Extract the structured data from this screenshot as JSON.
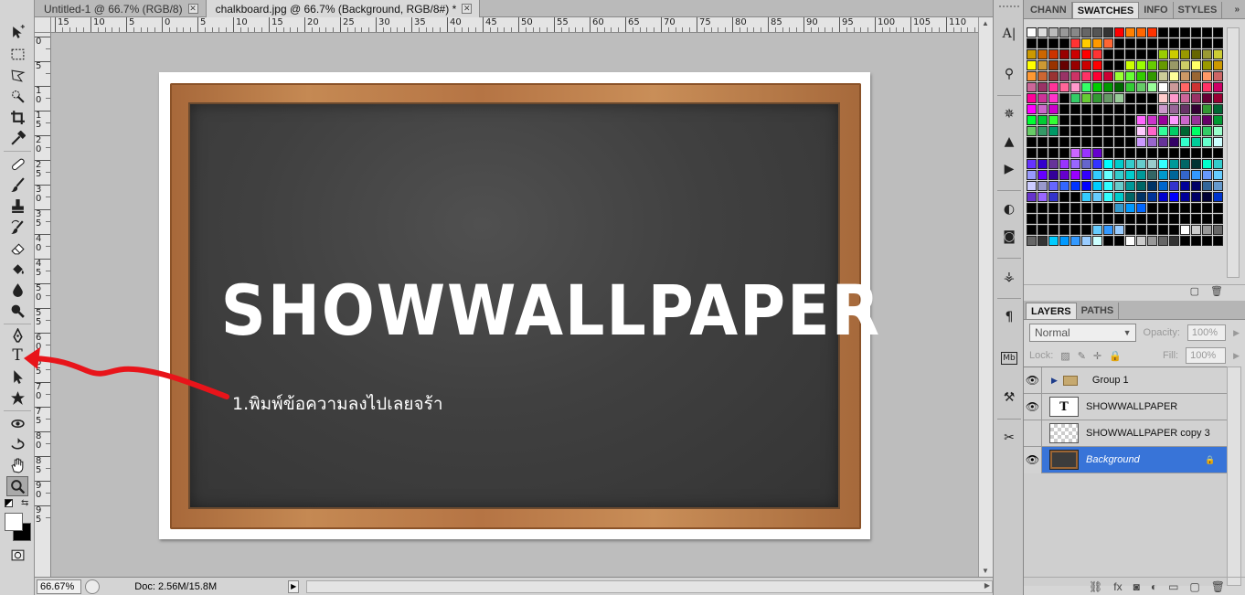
{
  "tabs": [
    {
      "label": "Untitled-1 @ 66.7% (RGB/8)",
      "close": "✕"
    },
    {
      "label": "chalkboard.jpg @ 66.7% (Background, RGB/8#) *",
      "close": "✕"
    }
  ],
  "ruler_top": [
    "15",
    "10",
    "5",
    "0",
    "5",
    "10",
    "15",
    "20",
    "25",
    "30",
    "35",
    "40",
    "45",
    "50",
    "55",
    "60",
    "65",
    "70",
    "75",
    "80",
    "85",
    "90",
    "95",
    "100",
    "105",
    "110"
  ],
  "ruler_left": [
    "0",
    "5",
    "1\n0",
    "1\n5",
    "2\n0",
    "2\n5",
    "3\n0",
    "3\n5",
    "4\n0",
    "4\n5",
    "5\n0",
    "5\n5",
    "6\n0",
    "6\n5",
    "7\n0",
    "7\n5",
    "8\n0",
    "8\n5",
    "9\n0",
    "9\n5"
  ],
  "canvas": {
    "title": "SHOWWALLPAPER",
    "annotation": "1.พิมพ์ข้อความลงไปเลยจร้า"
  },
  "status": {
    "zoom": "66.67%",
    "doc": "Doc: 2.56M/15.8M",
    "play": "▶"
  },
  "panel_top": {
    "tabs": [
      "CHANN",
      "SWATCHES",
      "INFO",
      "STYLES"
    ],
    "menu": "»",
    "footer": [
      "▢",
      "🗑"
    ]
  },
  "layers_panel": {
    "tabs": [
      "LAYERS",
      "PATHS"
    ],
    "blend_mode": "Normal",
    "opacity_label": "Opacity:",
    "opacity_value": "100%",
    "lock_label": "Lock:",
    "fill_label": "Fill:",
    "fill_value": "100%",
    "layers": [
      {
        "name": "Group 1",
        "visible": true,
        "type": "group"
      },
      {
        "name": "SHOWWALLPAPER",
        "visible": true,
        "type": "text"
      },
      {
        "name": "SHOWWALLPAPER copy 3",
        "visible": false,
        "type": "transparent"
      },
      {
        "name": "Background",
        "visible": true,
        "type": "image",
        "selected": true
      }
    ],
    "footer": [
      "⛓",
      "fx",
      "◙",
      "◐",
      "▭",
      "▢",
      "🗑"
    ]
  },
  "colors": {
    "selection": "#3874d8",
    "arrow": "#e8141a"
  }
}
